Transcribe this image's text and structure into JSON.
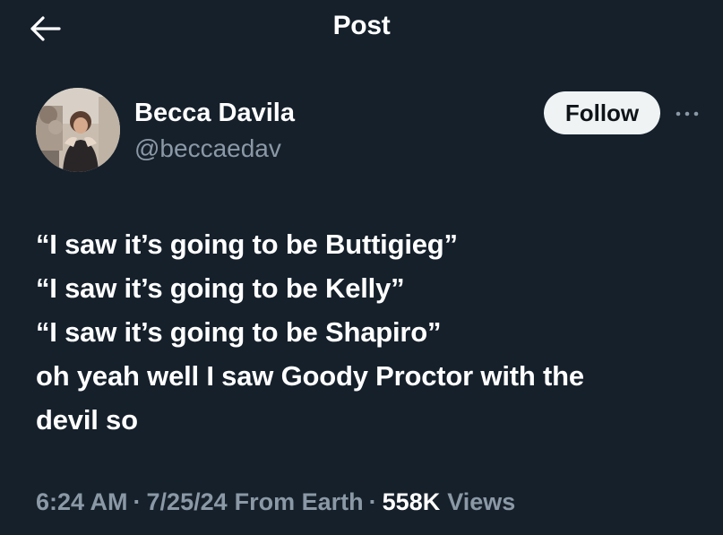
{
  "header": {
    "back_icon": "arrow-left-icon",
    "title": "Post"
  },
  "author": {
    "name": "Becca Davila",
    "handle": "@beccaedav",
    "follow_label": "Follow",
    "more_icon": "more-horizontal-icon"
  },
  "tweet": {
    "lines": [
      "“I saw it’s going to be Buttigieg”",
      "“I saw it’s going to be Kelly”",
      "“I saw it’s going to be Shapiro”",
      "oh yeah well I saw Goody Proctor with the",
      "devil so"
    ]
  },
  "meta": {
    "time": "6:24 AM",
    "separator": "·",
    "date": "7/25/24",
    "source": "From Earth",
    "views_count": "558K",
    "views_label": "Views"
  },
  "colors": {
    "background": "#15202b",
    "text_primary": "#ffffff",
    "text_secondary": "#8b98a5",
    "follow_button_bg": "#eff3f4",
    "follow_button_text": "#0f1419"
  }
}
